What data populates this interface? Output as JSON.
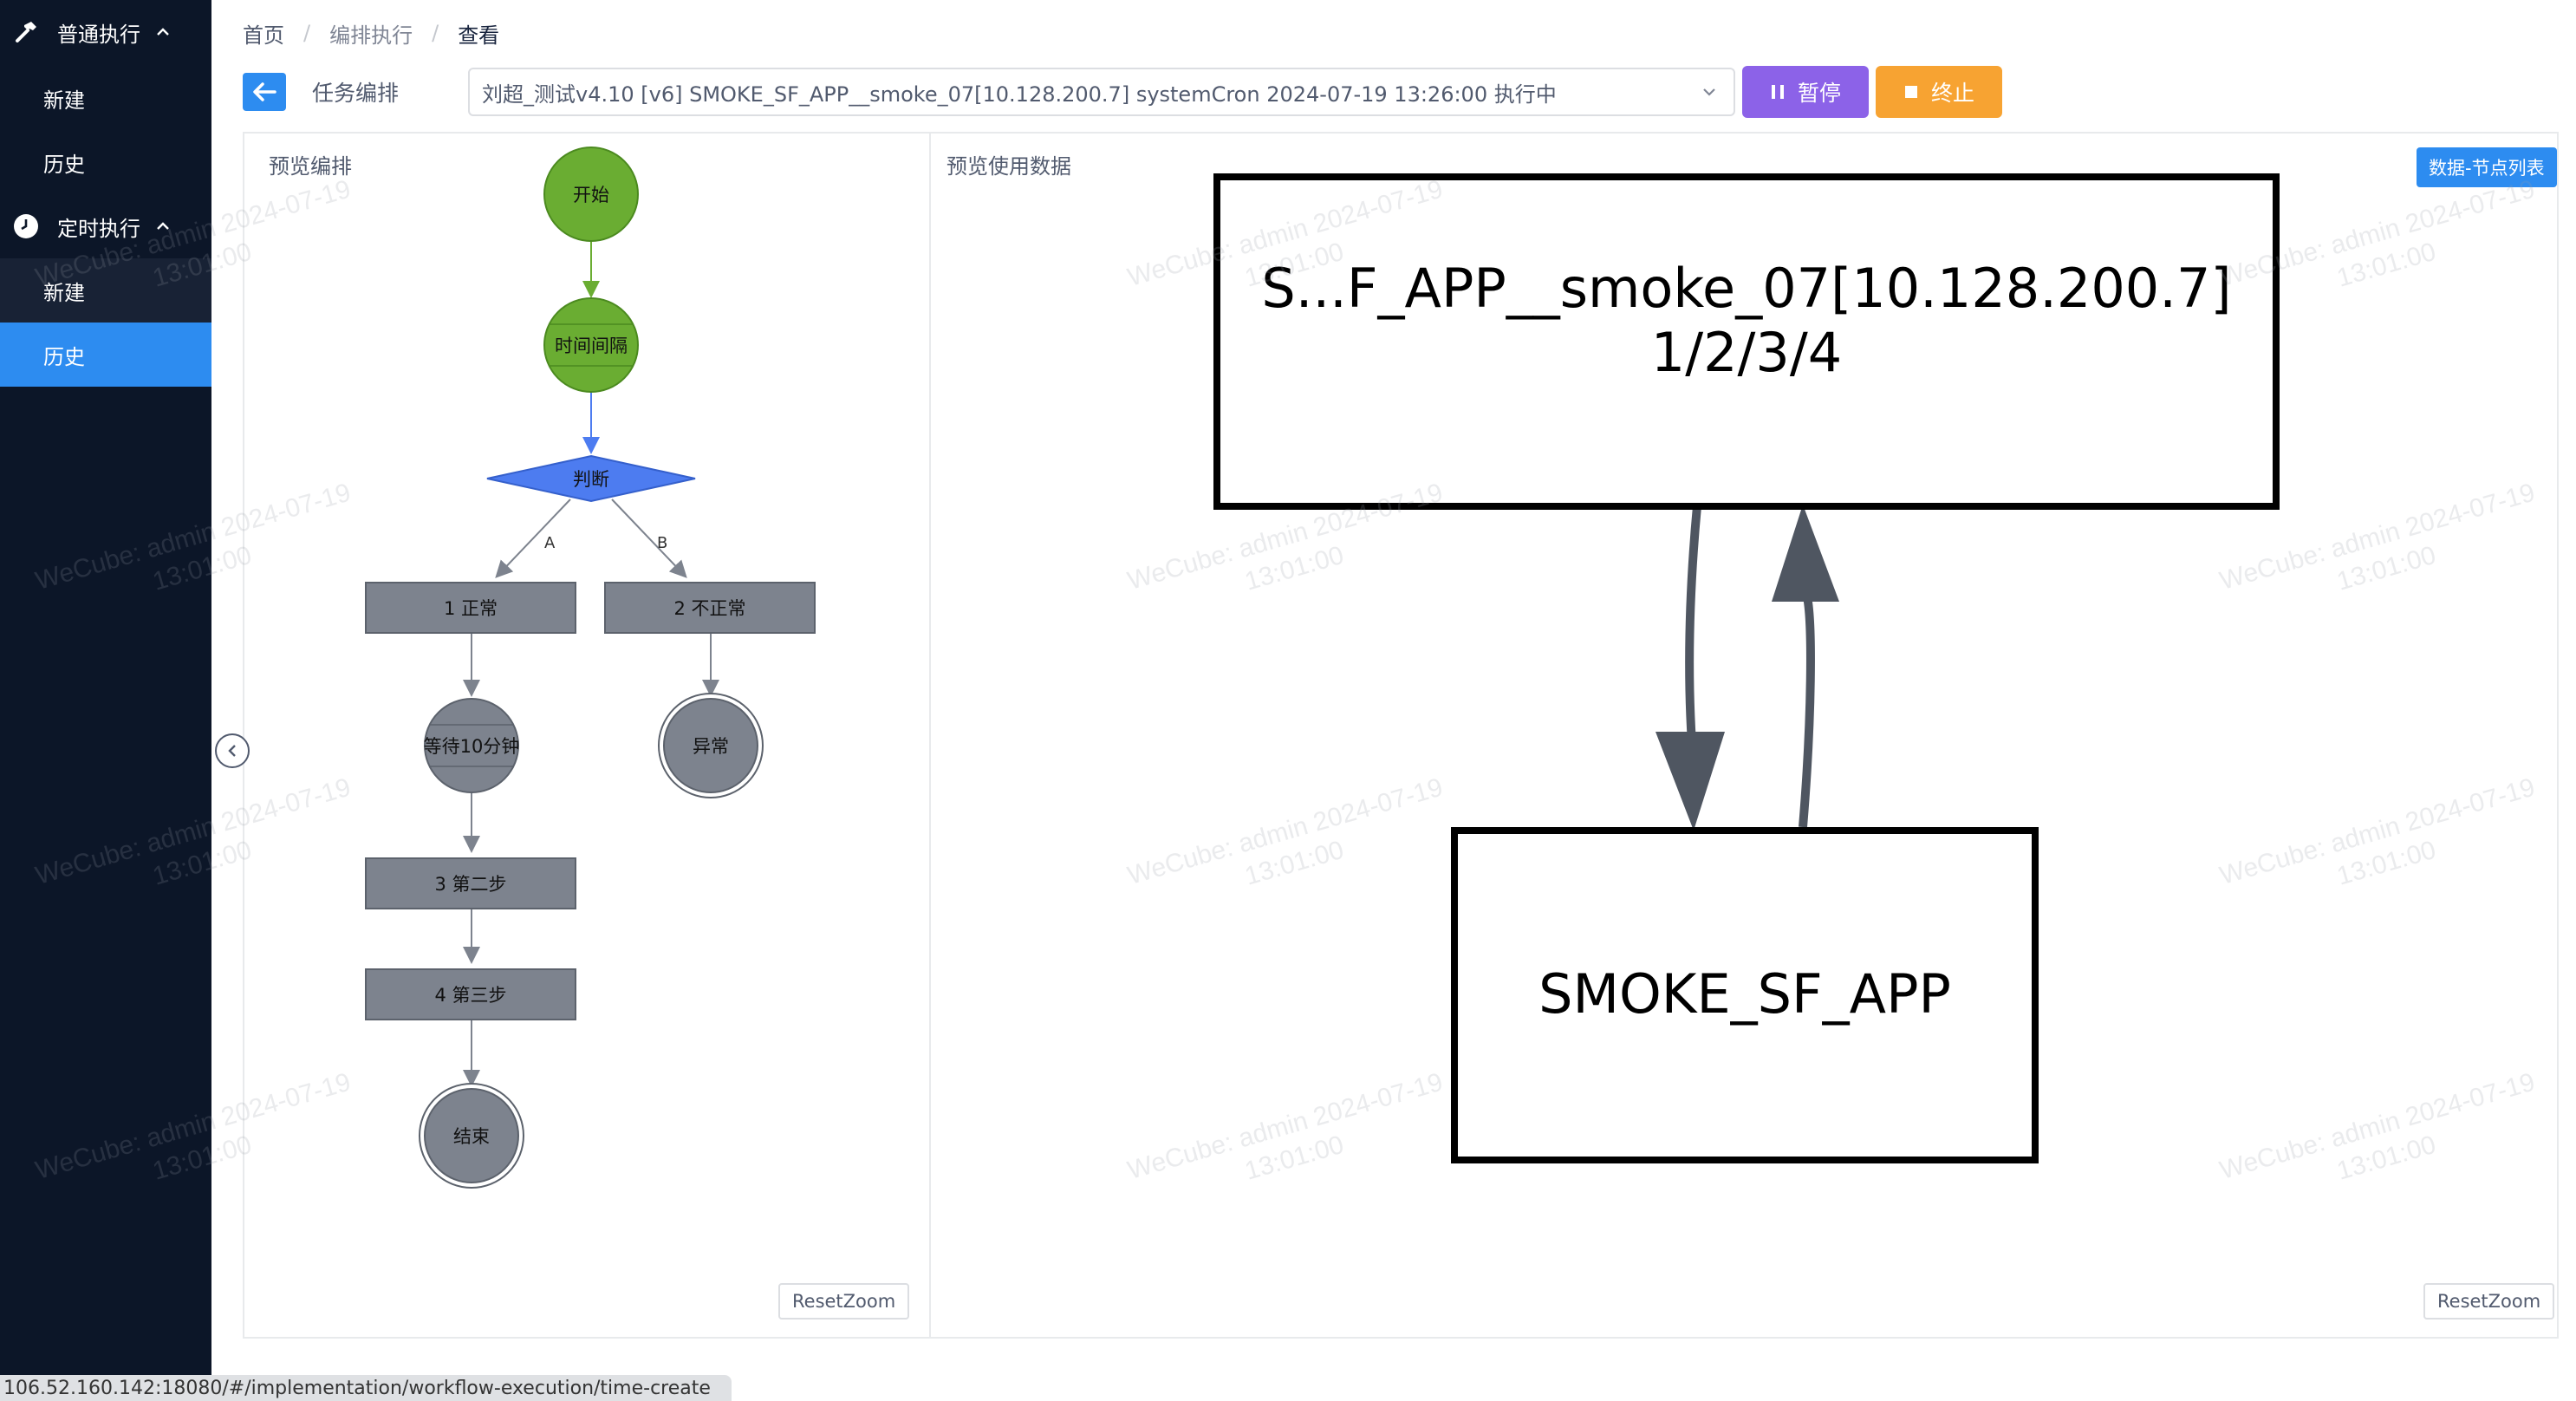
{
  "sidebar": {
    "groups": [
      {
        "label": "普通执行",
        "icon": "hammer-icon",
        "items": [
          {
            "label": "新建"
          },
          {
            "label": "历史"
          }
        ]
      },
      {
        "label": "定时执行",
        "icon": "clock-icon",
        "items": [
          {
            "label": "新建"
          },
          {
            "label": "历史",
            "active": true
          }
        ]
      }
    ]
  },
  "breadcrumb": [
    "首页",
    "编排执行",
    "查看"
  ],
  "toolbar": {
    "task_label": "任务编排",
    "selected_task": "刘超_测试v4.10  [v6]  SMOKE_SF_APP__smoke_07[10.128.200.7]  systemCron  2024-07-19 13:26:00  执行中",
    "pause_label": "暂停",
    "stop_label": "终止"
  },
  "left_panel": {
    "title": "预览编排",
    "reset_label": "ResetZoom",
    "flow": {
      "start": "开始",
      "timer": "时间间隔",
      "decision": "判断",
      "branch_a": "A",
      "branch_b": "B",
      "task1": "1 正常",
      "task2": "2 不正常",
      "wait": "等待10分钟",
      "error_end": "异常",
      "task3": "3 第二步",
      "task4": "4 第三步",
      "end": "结束"
    },
    "colors": {
      "done": "#6aad32",
      "active": "#4d7cf0",
      "pending": "#7d838e"
    }
  },
  "right_panel": {
    "title": "预览使用数据",
    "node_list_label": "数据-节点列表",
    "reset_label": "ResetZoom",
    "graph": {
      "top_node_line1": "S...F_APP__smoke_07[10.128.200.7]",
      "top_node_line2": "1/2/3/4",
      "bottom_node": "SMOKE_SF_APP"
    }
  },
  "watermark": {
    "line1": "WeCube: admin 2024-07-19",
    "line2": "13:01:00"
  },
  "status_url": "106.52.160.142:18080/#/implementation/workflow-execution/time-create"
}
